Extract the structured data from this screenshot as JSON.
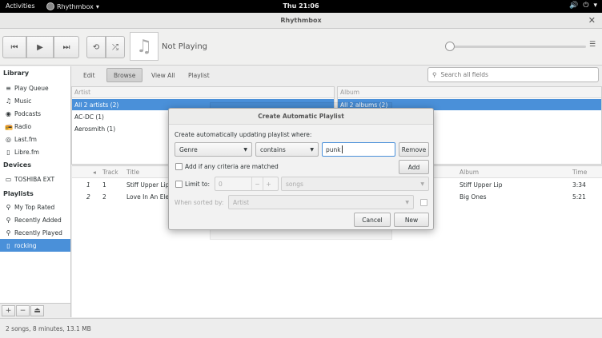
{
  "topbar": {
    "activities": "Activities",
    "app_name": "Rhythmbox",
    "clock": "Thu 21:06"
  },
  "window": {
    "title": "Rhythmbox"
  },
  "player": {
    "now_playing": "Not Playing",
    "volume_fraction": 0.0
  },
  "sidebar": {
    "library_header": "Library",
    "library_items": [
      {
        "label": "Play Queue",
        "icon": "queue-icon"
      },
      {
        "label": "Music",
        "icon": "music-note-icon"
      },
      {
        "label": "Podcasts",
        "icon": "podcast-icon"
      },
      {
        "label": "Radio",
        "icon": "radio-icon"
      },
      {
        "label": "Last.fm",
        "icon": "lastfm-icon"
      },
      {
        "label": "Libre.fm",
        "icon": "librefm-icon"
      }
    ],
    "devices_header": "Devices",
    "device_items": [
      {
        "label": "TOSHIBA EXT",
        "icon": "drive-icon"
      }
    ],
    "playlists_header": "Playlists",
    "playlist_items": [
      {
        "label": "My Top Rated",
        "icon": "smart-playlist-icon"
      },
      {
        "label": "Recently Added",
        "icon": "smart-playlist-icon"
      },
      {
        "label": "Recently Played",
        "icon": "smart-playlist-icon"
      },
      {
        "label": "rocking",
        "icon": "playlist-icon",
        "selected": true
      }
    ],
    "bottom_buttons": [
      "+",
      "−",
      "⏏"
    ]
  },
  "browse_bar": {
    "buttons": [
      "Edit",
      "Browse",
      "View All",
      "Playlist"
    ],
    "active": "Browse",
    "search_placeholder": "Search all fields"
  },
  "artist_pane": {
    "header": "Artist",
    "rows": [
      "All 2 artists (2)",
      "AC-DC (1)",
      "Aerosmith (1)"
    ],
    "selected_index": 0
  },
  "album_pane": {
    "header": "Album",
    "rows": [
      "All 2 albums (2)"
    ],
    "selected_index": 0
  },
  "tracks": {
    "columns": [
      "Track",
      "Title",
      "Album",
      "Time"
    ],
    "rows": [
      {
        "index": "1",
        "track": "1",
        "title": "Stiff Upper Lip",
        "album": "Stiff Upper Lip",
        "time": "3:34"
      },
      {
        "index": "2",
        "track": "2",
        "title": "Love In An Elev",
        "album": "Big Ones",
        "time": "5:21"
      }
    ]
  },
  "status": "2 songs, 8 minutes, 13.1 MB",
  "dialog": {
    "title": "Create Automatic Playlist",
    "prompt": "Create automatically updating playlist where:",
    "criteria_field": "Genre",
    "criteria_op": "contains",
    "criteria_value": "punk",
    "remove_label": "Remove",
    "add_label": "Add",
    "any_criteria_label": "Add if any criteria are matched",
    "limit_label": "Limit to:",
    "limit_value": "0",
    "limit_unit": "songs",
    "sort_label": "When sorted by:",
    "sort_value": "Artist",
    "cancel_label": "Cancel",
    "new_label": "New"
  }
}
